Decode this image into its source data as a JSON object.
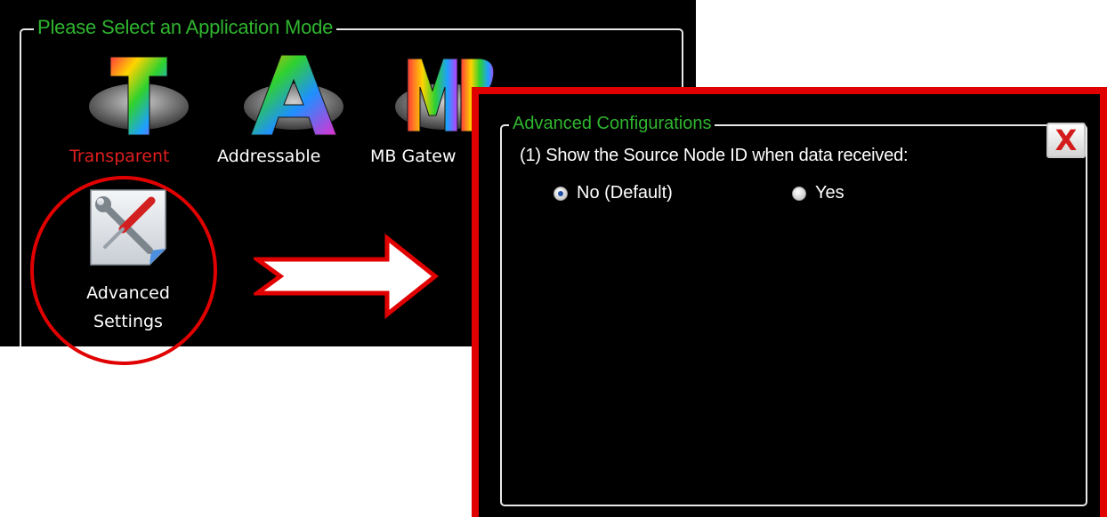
{
  "left_panel": {
    "group_title": "Please Select an Application Mode",
    "modes": [
      {
        "label": "Transparent",
        "glyph": "T",
        "selected": true
      },
      {
        "label": "Addressable",
        "glyph": "A",
        "selected": false
      },
      {
        "label": "MB Gatew",
        "glyph": "MB",
        "selected": false
      }
    ],
    "advanced_settings": {
      "line1": "Advanced",
      "line2": "Settings",
      "icon": "tools-icon"
    }
  },
  "annotations": {
    "highlight_color": "#e10000",
    "arrow": "right-arrow"
  },
  "dialog": {
    "group_title": "Advanced Configurations",
    "close_glyph": "X",
    "question": "(1) Show the Source Node ID when data received:",
    "options": [
      {
        "label": "No (Default)",
        "checked": true
      },
      {
        "label": "Yes",
        "checked": false
      }
    ]
  },
  "colors": {
    "background": "#000000",
    "title_green": "#2fb52f",
    "selected_red": "#e01e1e",
    "annotation_red": "#e10000"
  }
}
